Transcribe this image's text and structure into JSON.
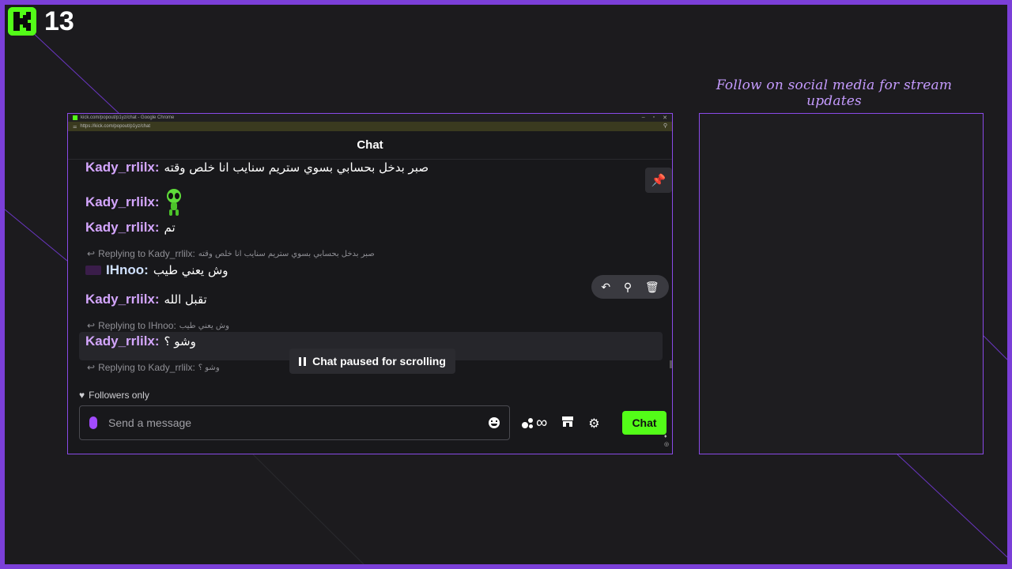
{
  "overlay": {
    "viewer_count": "13",
    "social_text": "Follow on social media for stream updates"
  },
  "browser": {
    "title": "kick.com/popout/p1yz/chat - Google Chrome",
    "url": "https://kick.com/popout/p1yz/chat",
    "controls": [
      "–",
      "▫",
      "✕"
    ]
  },
  "chat": {
    "header": "Chat",
    "messages": [
      {
        "user": "Kady_rrlilx:",
        "text": "صبر بدخل بحسابي بسوي ستريم سنايب انا خلص وقته"
      },
      {
        "user": "Kady_rrlilx:",
        "text": ""
      },
      {
        "user": "Kady_rrlilx:",
        "text": "تم"
      },
      {
        "user": "IHnoo:",
        "text": "وش يعني طيب"
      },
      {
        "user": "Kady_rrlilx:",
        "text": "تقبل الله"
      },
      {
        "user": "Kady_rrlilx:",
        "text": "وشو ؟"
      }
    ],
    "replies": [
      {
        "label": "Replying to Kady_rrlilx:",
        "text": "صبر بدخل بحسابي بسوي ستريم سنايب انا خلص وقته"
      },
      {
        "label": "Replying to IHnoo:",
        "text": "وش يعني طيب"
      },
      {
        "label": "Replying to Kady_rrlilx:",
        "text": "وشو ؟"
      }
    ],
    "paused_label": "Chat paused for scrolling",
    "followers_label": "Followers only",
    "input_placeholder": "Send a message",
    "send_label": "Chat",
    "infinity_symbol": "∞"
  },
  "colors": {
    "accent": "#53fc18",
    "frame": "#7b3fd8",
    "username": "#d4a6ff"
  }
}
